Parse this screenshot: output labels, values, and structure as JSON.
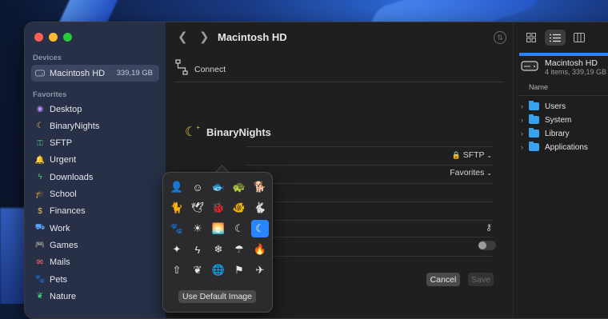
{
  "window": {
    "title": "Macintosh HD"
  },
  "sidebar": {
    "devices_label": "Devices",
    "device": {
      "label": "Macintosh HD",
      "size": "339,19 GB",
      "icon": "drive-icon"
    },
    "favorites_label": "Favorites",
    "items": [
      {
        "label": "Desktop",
        "icon": "person-icon",
        "color": "#b98cff"
      },
      {
        "label": "BinaryNights",
        "icon": "moon-stars-icon",
        "color": "#e8c24a"
      },
      {
        "label": "SFTP",
        "icon": "key-icon",
        "color": "#44d07a"
      },
      {
        "label": "Urgent",
        "icon": "bell-icon",
        "color": "#ff5f57"
      },
      {
        "label": "Downloads",
        "icon": "bolt-icon",
        "color": "#44d07a"
      },
      {
        "label": "School",
        "icon": "graduation-icon",
        "color": "#c4c9d6"
      },
      {
        "label": "Finances",
        "icon": "dollar-icon",
        "color": "#e8c24a"
      },
      {
        "label": "Work",
        "icon": "car-icon",
        "color": "#5aa4ff"
      },
      {
        "label": "Games",
        "icon": "gamepad-icon",
        "color": "#5aa4ff"
      },
      {
        "label": "Mails",
        "icon": "mail-icon",
        "color": "#ff6b6b"
      },
      {
        "label": "Pets",
        "icon": "paw-icon",
        "color": "#ff8a3d"
      },
      {
        "label": "Nature",
        "icon": "leaf-icon",
        "color": "#44d07a"
      }
    ]
  },
  "main": {
    "connect_label": "Connect",
    "server_name": "BinaryNights",
    "protocol": "SFTP",
    "favorites_value": "Favorites",
    "cancel_label": "Cancel",
    "save_label": "Save"
  },
  "icon_picker": {
    "icons": [
      "person-icon",
      "smiley-icon",
      "fish-icon",
      "turtle-icon",
      "dog-icon",
      "cat-icon",
      "bird-icon",
      "ladybug-icon",
      "fish-2-icon",
      "hare-icon",
      "paw-icon",
      "sun-icon",
      "sunrise-icon",
      "moon-icon",
      "moon-stars-icon",
      "sparkles-icon",
      "bolt-icon",
      "snowflake-icon",
      "umbrella-icon",
      "flame-icon",
      "cloud-upload-icon",
      "leaf-icon",
      "globe-icon",
      "flag-icon",
      "airplane-icon"
    ],
    "glyphs": [
      "👤",
      "☺",
      "🐟",
      "🐢",
      "🐕",
      "🐈",
      "🕊",
      "🐞",
      "🐠",
      "🐇",
      "🐾",
      "☀",
      "🌅",
      "☾",
      "☾",
      "✦",
      "ϟ",
      "❄",
      "☂",
      "🔥",
      "⇧",
      "❦",
      "🌐",
      "⚑",
      "✈"
    ],
    "selected_index": 14,
    "default_button": "Use Default Image"
  },
  "right_panel": {
    "disk_name": "Macintosh HD",
    "disk_info": "4 items, 339,19 GB",
    "column_header": "Name",
    "files": [
      "Users",
      "System",
      "Library",
      "Applications"
    ]
  }
}
